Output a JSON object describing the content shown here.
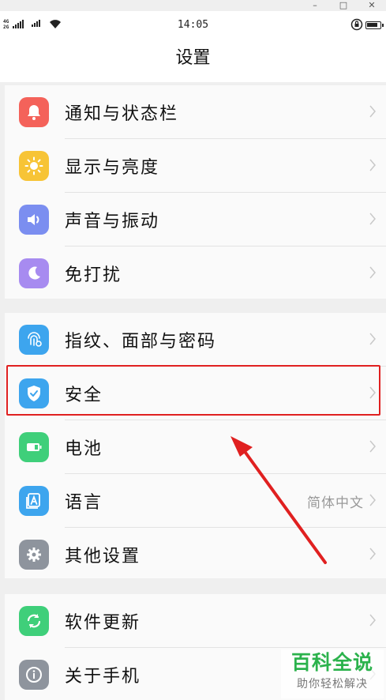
{
  "window_controls": {
    "minimize": "–",
    "maximize": "□",
    "close": "✕"
  },
  "status_bar": {
    "network_labels": [
      "4G",
      "2G"
    ],
    "time": "14:05",
    "icons": [
      "signal-icon",
      "wifi-icon",
      "rotation-lock-icon",
      "battery-icon"
    ]
  },
  "header": {
    "title": "设置"
  },
  "groups": [
    {
      "items": [
        {
          "label": "通知与状态栏",
          "icon": "bell-icon",
          "color": "#f4625a"
        },
        {
          "label": "显示与亮度",
          "icon": "sun-icon",
          "color": "#f7c436"
        },
        {
          "label": "声音与振动",
          "icon": "speaker-icon",
          "color": "#7b8ef0"
        },
        {
          "label": "免打扰",
          "icon": "moon-icon",
          "color": "#a78bf0"
        }
      ]
    },
    {
      "items": [
        {
          "label": "指纹、面部与密码",
          "icon": "fingerprint-icon",
          "color": "#3da5ee"
        },
        {
          "label": "安全",
          "icon": "shield-icon",
          "color": "#3da5ee",
          "highlighted": true
        },
        {
          "label": "电池",
          "icon": "battery-icon",
          "color": "#3fcf7a"
        },
        {
          "label": "语言",
          "icon": "language-icon",
          "color": "#3da5ee",
          "value": "简体中文"
        },
        {
          "label": "其他设置",
          "icon": "gear-icon",
          "color": "#8e949d"
        }
      ]
    },
    {
      "items": [
        {
          "label": "软件更新",
          "icon": "refresh-icon",
          "color": "#3fcf7a"
        },
        {
          "label": "关于手机",
          "icon": "info-icon",
          "color": "#8e949d"
        }
      ]
    }
  ],
  "annotation": {
    "highlight_color": "#e02020",
    "target": "安全"
  },
  "watermark": {
    "line1": "百科全说",
    "line2": "助你轻松解决"
  }
}
